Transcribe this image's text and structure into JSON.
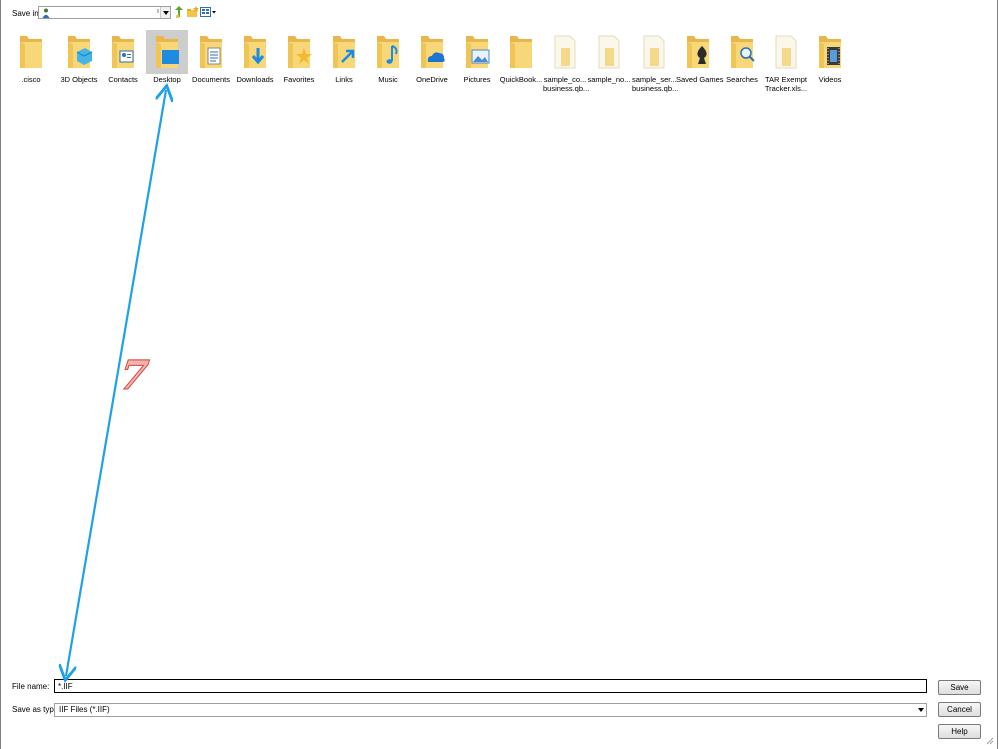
{
  "toolbar": {
    "save_in_label": "Save in:",
    "save_in_value": "ı"
  },
  "items": [
    {
      "label": ".cisco",
      "label2": "",
      "icon": "folder-icon"
    },
    {
      "label": "3D Objects",
      "label2": "",
      "icon": "3d-objects-folder-icon"
    },
    {
      "label": "Contacts",
      "label2": "",
      "icon": "contacts-folder-icon"
    },
    {
      "label": "Desktop",
      "label2": "",
      "icon": "desktop-folder-icon",
      "selected": true
    },
    {
      "label": "Documents",
      "label2": "",
      "icon": "documents-folder-icon"
    },
    {
      "label": "Downloads",
      "label2": "",
      "icon": "downloads-folder-icon"
    },
    {
      "label": "Favorites",
      "label2": "",
      "icon": "favorites-folder-icon"
    },
    {
      "label": "Links",
      "label2": "",
      "icon": "links-folder-icon"
    },
    {
      "label": "Music",
      "label2": "",
      "icon": "music-folder-icon"
    },
    {
      "label": "OneDrive",
      "label2": "",
      "icon": "onedrive-folder-icon"
    },
    {
      "label": "Pictures",
      "label2": "",
      "icon": "pictures-folder-icon"
    },
    {
      "label": "QuickBook...",
      "label2": "",
      "icon": "folder-icon"
    },
    {
      "label": "sample_co...",
      "label2": "business.qb...",
      "icon": "file-icon"
    },
    {
      "label": "sample_no...",
      "label2": "",
      "icon": "file-icon"
    },
    {
      "label": "sample_ser...",
      "label2": "business.qb...",
      "icon": "file-icon"
    },
    {
      "label": "Saved Games",
      "label2": "",
      "icon": "saved-games-folder-icon"
    },
    {
      "label": "Searches",
      "label2": "",
      "icon": "searches-folder-icon"
    },
    {
      "label": "TAR Exempt",
      "label2": "Tracker.xls...",
      "icon": "file-icon"
    },
    {
      "label": "Videos",
      "label2": "",
      "icon": "videos-folder-icon"
    }
  ],
  "file_name": {
    "label": "File name:",
    "value": "*.IIF"
  },
  "save_as_type": {
    "label": "Save as type:",
    "value": "IIF Files (*.IIF)"
  },
  "buttons": {
    "save": "Save",
    "cancel": "Cancel",
    "help": "Help"
  },
  "annotation": {
    "step_number": "7",
    "arrow_color": "#1ea1e6"
  }
}
